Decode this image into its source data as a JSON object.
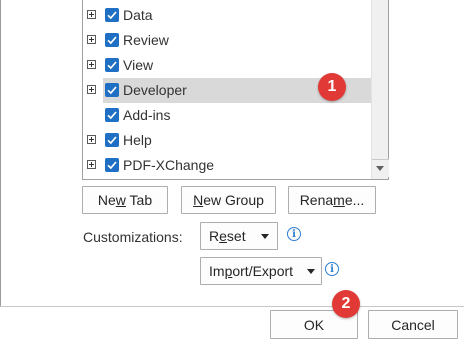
{
  "tree": {
    "items": [
      {
        "label": "Data",
        "expandable": true,
        "checked": true,
        "selected": false
      },
      {
        "label": "Review",
        "expandable": true,
        "checked": true,
        "selected": false
      },
      {
        "label": "View",
        "expandable": true,
        "checked": true,
        "selected": false
      },
      {
        "label": "Developer",
        "expandable": true,
        "checked": true,
        "selected": true
      },
      {
        "label": "Add-ins",
        "expandable": false,
        "checked": true,
        "selected": false
      },
      {
        "label": "Help",
        "expandable": true,
        "checked": true,
        "selected": false
      },
      {
        "label": "PDF-XChange",
        "expandable": true,
        "checked": true,
        "selected": false
      }
    ]
  },
  "buttons": {
    "new_tab": {
      "pre": "Ne",
      "key": "w",
      "post": " Tab"
    },
    "new_group": {
      "pre": "",
      "key": "N",
      "post": "ew Group"
    },
    "rename": {
      "pre": "Rena",
      "key": "m",
      "post": "e..."
    }
  },
  "customizations": {
    "label": "Customizations:",
    "reset": {
      "pre": "R",
      "key": "e",
      "post": "set"
    },
    "import_export": {
      "pre": "Im",
      "key": "p",
      "post": "ort/Export"
    }
  },
  "footer": {
    "ok_label": "OK",
    "cancel_label": "Cancel"
  },
  "badges": {
    "step1": "1",
    "step2": "2"
  },
  "colors": {
    "checkbox": "#1f6fc4",
    "selection": "#d9d9d9",
    "badge": "#e13a36",
    "info": "#2d7fd1"
  },
  "icons": {
    "expander": "plus-box-icon",
    "check": "checkmark-icon",
    "info": "info-icon",
    "dropdown": "chevron-down-icon"
  }
}
